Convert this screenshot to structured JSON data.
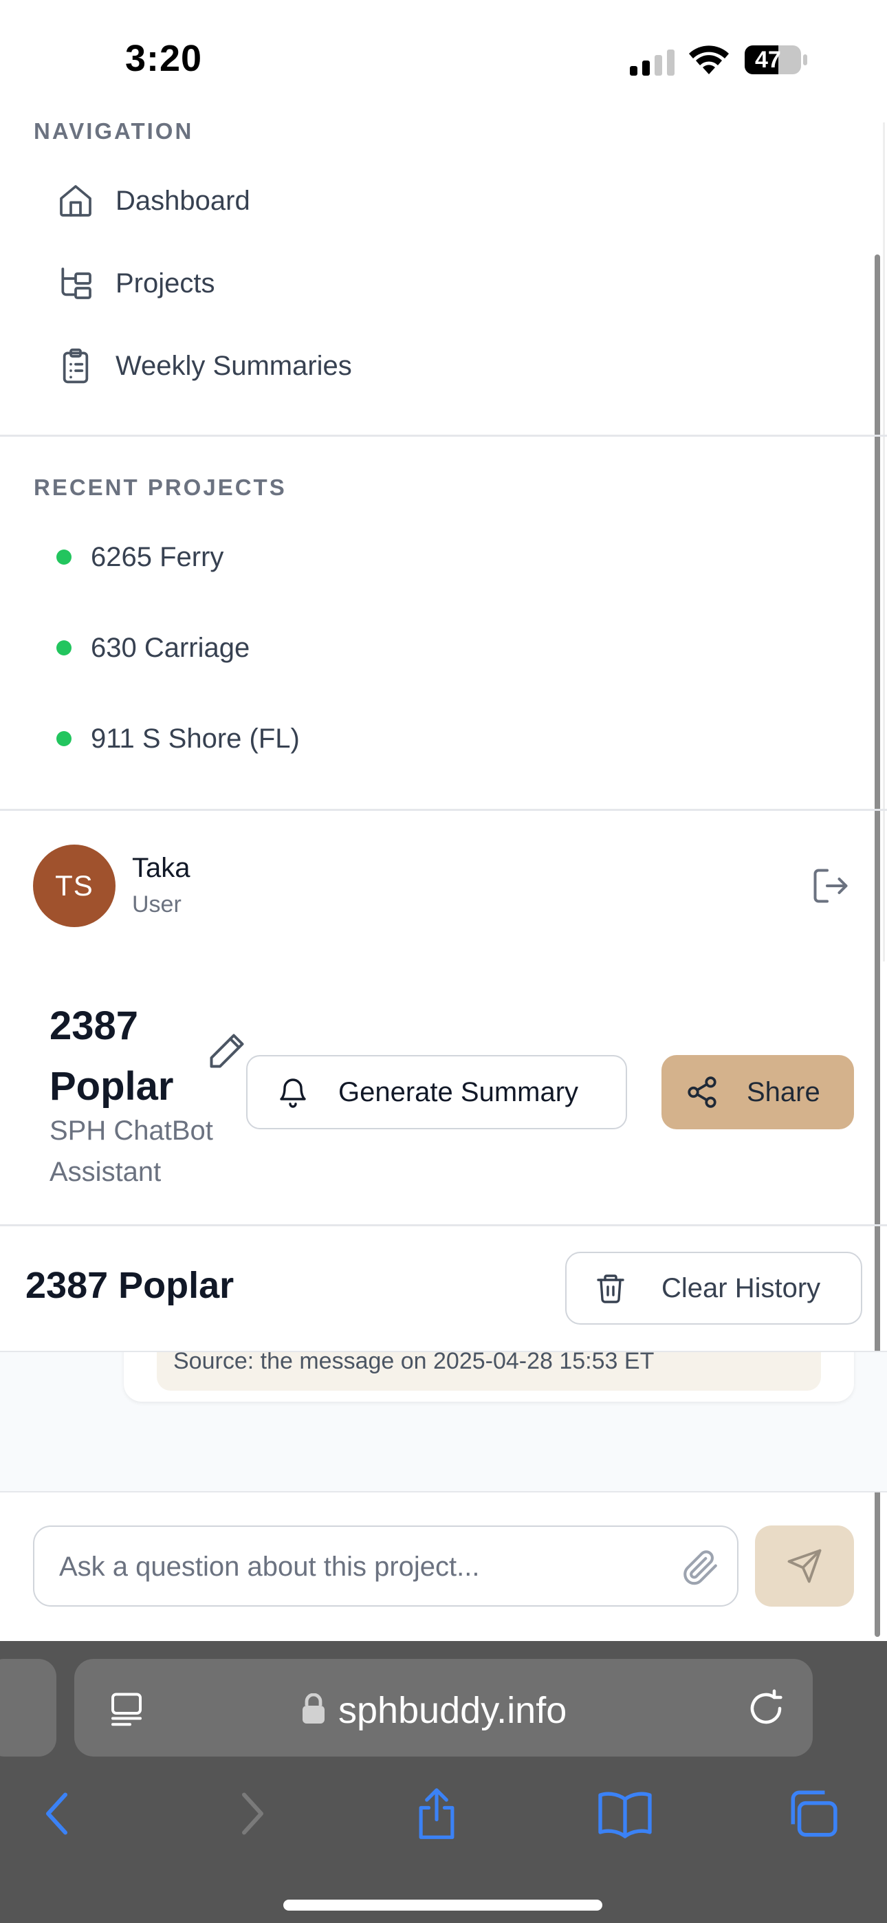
{
  "status_bar": {
    "time": "3:20",
    "battery": "47"
  },
  "navigation": {
    "title": "NAVIGATION",
    "items": [
      {
        "label": "Dashboard",
        "icon": "home-icon"
      },
      {
        "label": "Projects",
        "icon": "folder-tree-icon"
      },
      {
        "label": "Weekly Summaries",
        "icon": "clipboard-list-icon"
      }
    ]
  },
  "recent_projects": {
    "title": "RECENT PROJECTS",
    "items": [
      {
        "label": "6265 Ferry",
        "status_color": "#22c55e"
      },
      {
        "label": "630 Carriage",
        "status_color": "#22c55e"
      },
      {
        "label": "911 S Shore (FL)",
        "status_color": "#22c55e"
      }
    ]
  },
  "user": {
    "initials": "TS",
    "name": "Taka",
    "role": "User",
    "avatar_color": "#a0522d"
  },
  "project_header": {
    "title": "2387 Poplar",
    "subtitle": "SPH ChatBot Assistant",
    "generate_label": "Generate Summary",
    "share_label": "Share",
    "share_color": "#d4b28c"
  },
  "chat": {
    "title": "2387 Poplar",
    "clear_label": "Clear History",
    "source_text": "Source: the message on 2025-04-28 15:53 ET",
    "input_placeholder": "Ask a question about this project..."
  },
  "browser": {
    "url": "sphbuddy.info"
  }
}
